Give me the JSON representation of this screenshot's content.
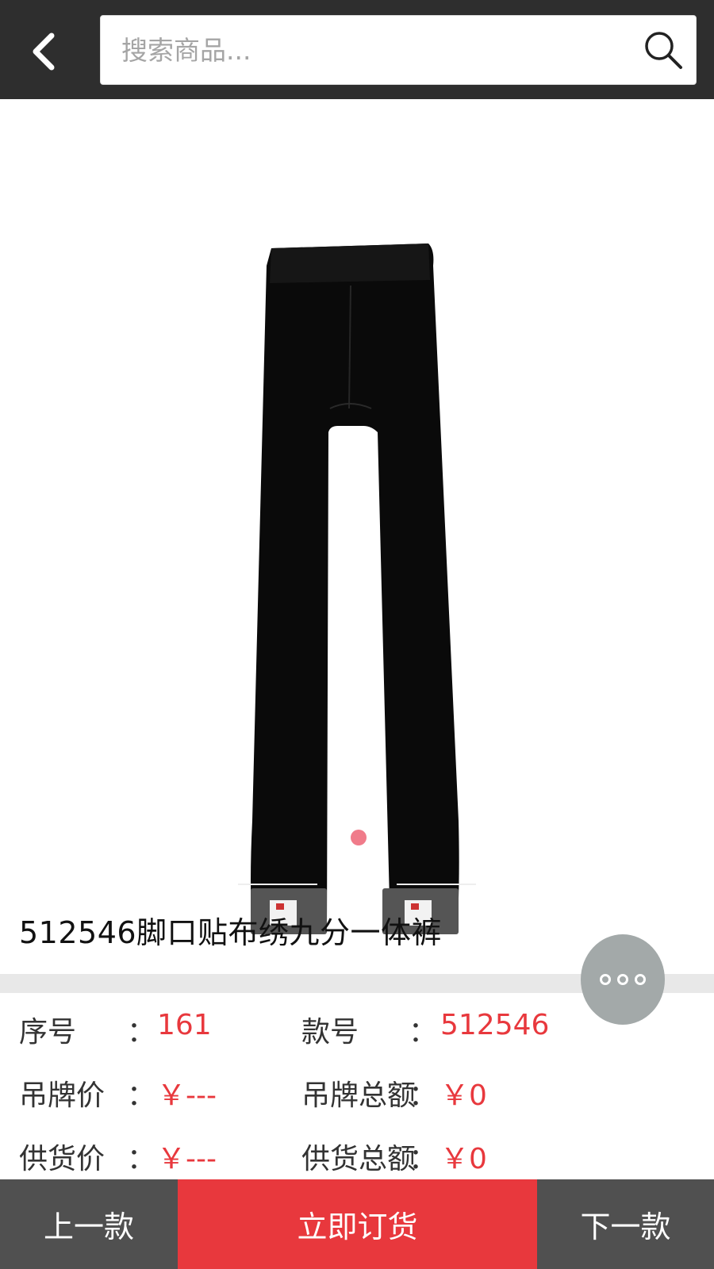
{
  "header": {
    "search_placeholder": "搜索商品...",
    "back_icon": "chevron-left-icon",
    "search_icon": "search-icon"
  },
  "gallery": {
    "image_alt": "black leggings",
    "slide_count": 1,
    "active_slide": 1
  },
  "product": {
    "title": "512546脚口贴布绣九分一体裤"
  },
  "info": {
    "seq_label": "序号",
    "seq_value": "161",
    "style_label": "款号",
    "style_value": "512546",
    "tag_price_label": "吊牌价",
    "tag_price_value": "￥---",
    "tag_total_label": "吊牌总额",
    "tag_total_value": "￥0",
    "supply_price_label": "供货价",
    "supply_price_value": "￥---",
    "supply_total_label": "供货总额",
    "supply_total_value": "￥0",
    "colon": "："
  },
  "more_icon": "more-dots-icon",
  "bottom": {
    "prev_label": "上一款",
    "order_label": "立即订货",
    "next_label": "下一款"
  },
  "colors": {
    "header_bg": "#2e2e2e",
    "accent_red": "#e8383d",
    "bottom_gray": "#505050",
    "dot_pink": "#f07b8a"
  }
}
